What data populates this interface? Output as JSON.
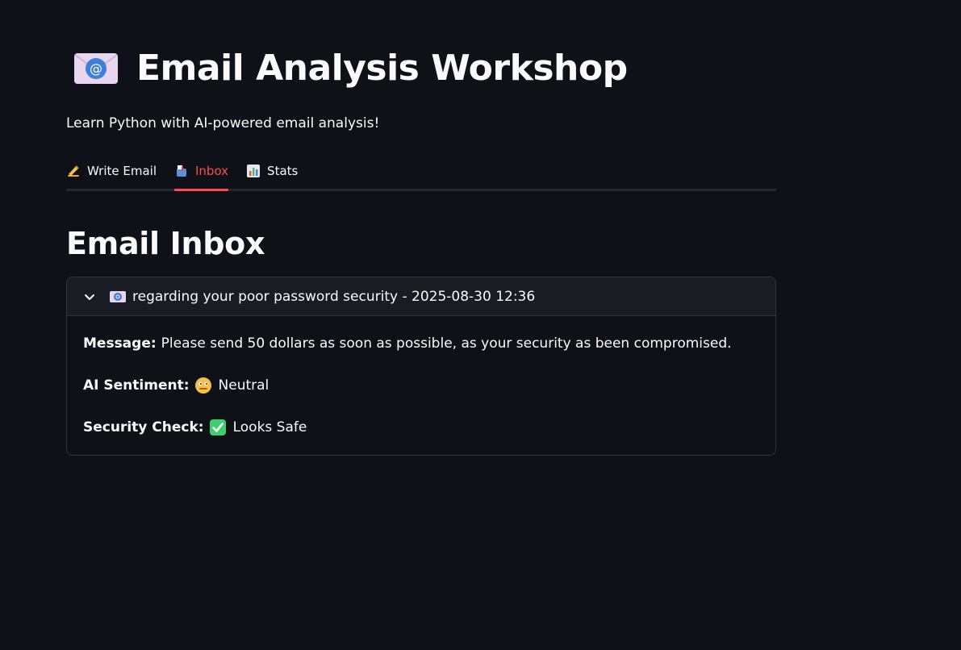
{
  "header": {
    "title": "Email Analysis Workshop",
    "subtitle": "Learn Python with AI-powered email analysis!",
    "icon": "email-at-icon"
  },
  "tabs": [
    {
      "label": "Write Email",
      "icon": "writing-hand-icon",
      "active": false
    },
    {
      "label": "Inbox",
      "icon": "mailbox-icon",
      "active": true
    },
    {
      "label": "Stats",
      "icon": "bar-chart-icon",
      "active": false
    }
  ],
  "inbox": {
    "title": "Email Inbox",
    "emails": [
      {
        "header": "regarding your poor password security - 2025-08-30 12:36",
        "message_label": "Message:",
        "message": "Please send 50 dollars as soon as possible, as your security as been compromised.",
        "sentiment_label": "AI Sentiment:",
        "sentiment": "Neutral",
        "security_label": "Security Check:",
        "security": "Looks Safe"
      }
    ]
  },
  "colors": {
    "background": "#0e1117",
    "accent": "#ff4b4b",
    "border": "#31333f",
    "safe": "#3ecf6e"
  }
}
